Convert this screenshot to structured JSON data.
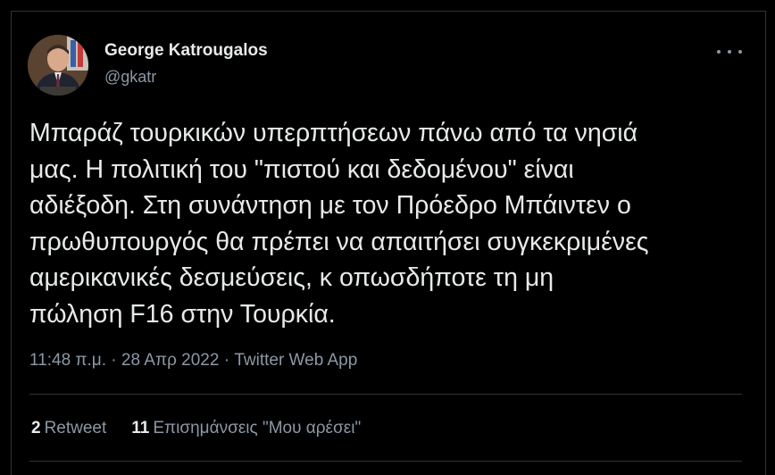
{
  "tweet": {
    "author_name": "George Katrougalos",
    "author_handle": "@gkatr",
    "text": "Μπαράζ τουρκικών υπερπτήσεων πάνω από τα νησιά\nμας. Η πολιτική του \"πιστού και δεδομένου\" είναι\nαδιέξοδη. Στη συνάντηση με τον Πρόεδρο Μπάιντεν ο\nπρωθυπουργός θα πρέπει να απαιτήσει συγκεκριμένες\nαμερικανικές δεσμεύσεις, κ οπωσδήποτε τη μη\nπώληση F16 στην Τουρκία.",
    "time": "11:48 π.μ.",
    "separator": " · ",
    "date": "28 Απρ 2022",
    "source": "Twitter Web App",
    "retweet_count": "2",
    "retweet_label": "Retweet",
    "like_count": "11",
    "like_label": "Επισημάνσεις \"Μου αρέσει\""
  },
  "icons": {
    "more": "more-horizontal-icon"
  },
  "colors": {
    "background": "#000000",
    "primary_text": "#e7e9ea",
    "secondary_text": "#8b98a5",
    "divider": "#2f3336"
  }
}
